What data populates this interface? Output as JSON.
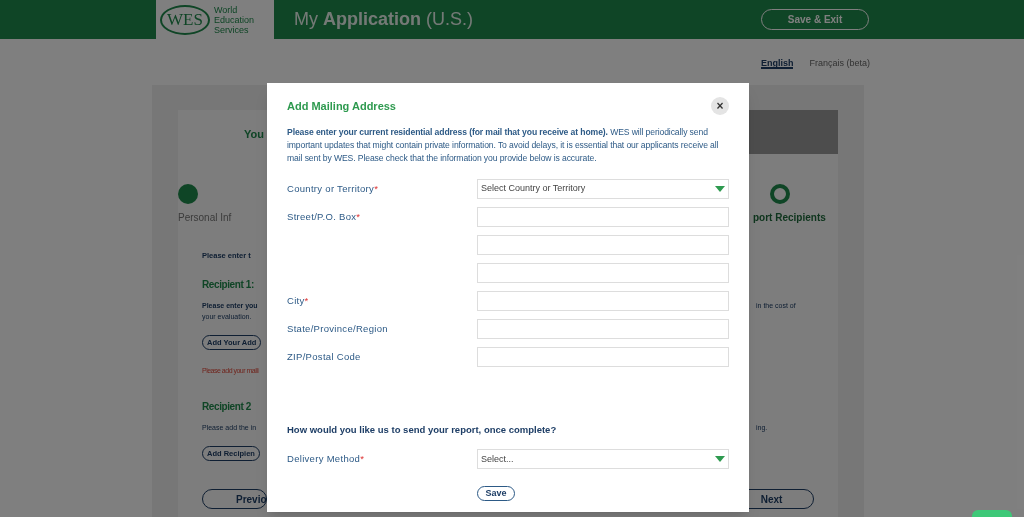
{
  "header": {
    "logo": "WES",
    "logo_caption": [
      "World",
      "Education",
      "Services"
    ],
    "title": "My **Application** (U.S.)",
    "save_exit": "Save & Exit"
  },
  "languages": [
    {
      "label": "English",
      "selected": true
    },
    {
      "label": "Français (beta)",
      "selected": false
    }
  ],
  "page": {
    "banner": "You",
    "steps": [
      {
        "label": "Personal Inf",
        "kind": "filled"
      },
      {
        "label": "port Recipients",
        "kind": "ring"
      }
    ],
    "intro": "Please enter t",
    "recipients": [
      {
        "title": "Recipient 1:",
        "text_left": "Please enter you",
        "text_right": "in the cost of",
        "text_left_2": "your evaluation.",
        "button": "Add Your Add",
        "error": "Please add your maili"
      },
      {
        "title": "Recipient 2",
        "text_left": "Please add the in",
        "text_right": "ing.",
        "button": "Add Recipien"
      }
    ],
    "nav": [
      {
        "label": "Previo"
      },
      {
        "label": "Next"
      }
    ]
  },
  "modal": {
    "title": "Add Mailing Address",
    "close": "×",
    "intro": "**Please enter your current residential address (for mail that you receive at home).** WES will periodically send important updates that might contain private information. To avoid delays, it is essential that our applicants receive all mail sent by WES. Please check that the information you provide below is accurate.",
    "required_mark": "*",
    "fields": [
      {
        "label": "Country or Territory",
        "required": true,
        "kind": "select",
        "placeholder": "Select Country or Territory"
      },
      {
        "label": "Street/P.O. Box",
        "required": true,
        "kind": "text"
      },
      {
        "kind": "text"
      },
      {
        "kind": "text"
      },
      {
        "label": "City",
        "required": true,
        "kind": "text"
      },
      {
        "label": "State/Province/Region",
        "required": false,
        "kind": "text"
      },
      {
        "label": "ZIP/Postal Code",
        "required": false,
        "kind": "text"
      }
    ],
    "question": "How would you like us to send your report, once complete?",
    "delivery": [
      {
        "label": "Delivery Method",
        "required": true,
        "kind": "select",
        "placeholder": "Select..."
      }
    ],
    "save": "Save"
  }
}
